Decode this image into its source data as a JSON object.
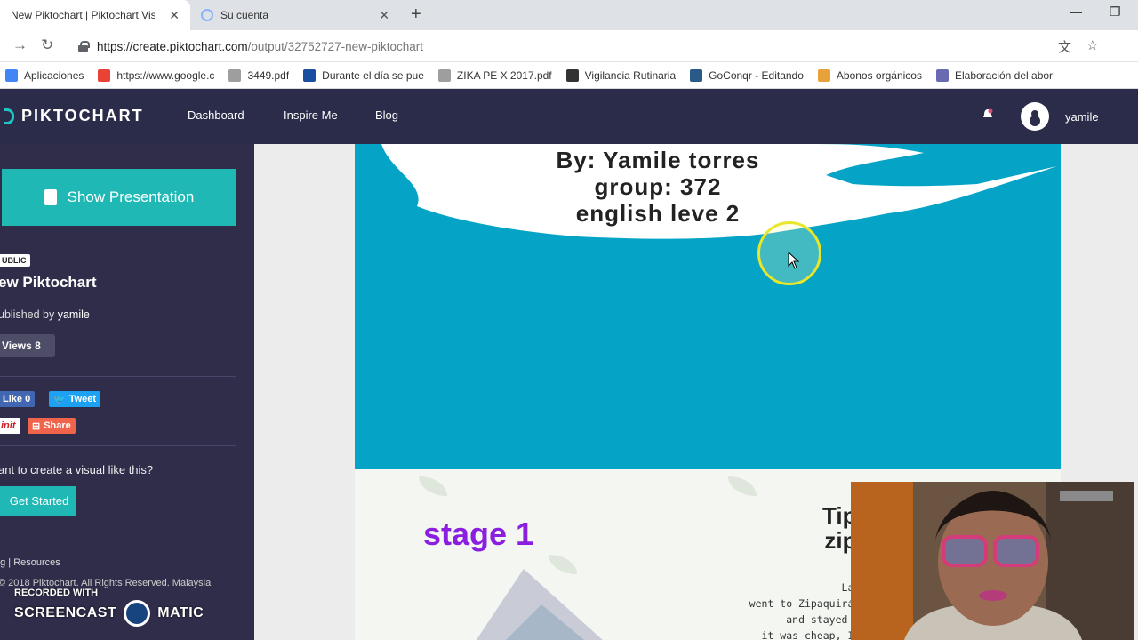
{
  "browser": {
    "tabs": [
      {
        "title": "New Piktochart | Piktochart Visual",
        "close": "✕"
      },
      {
        "title": "Su cuenta",
        "close": "✕"
      }
    ],
    "new_tab": "+",
    "url_host": "https://create.piktochart.com",
    "url_path": "/output/32752727-new-piktochart",
    "bookmarks": [
      {
        "label": "Aplicaciones",
        "color": "#4285f4"
      },
      {
        "label": "https://www.google.c",
        "color": "#ea4335"
      },
      {
        "label": "3449.pdf",
        "color": "#9e9e9e"
      },
      {
        "label": "Durante el día se pue",
        "color": "#1a4fa0"
      },
      {
        "label": "ZIKA PE X 2017.pdf",
        "color": "#9e9e9e"
      },
      {
        "label": "Vigilancia Rutinaria",
        "color": "#333333"
      },
      {
        "label": "GoConqr - Editando",
        "color": "#2a5a8a"
      },
      {
        "label": "Abonos orgánicos",
        "color": "#e8a23a"
      },
      {
        "label": "Elaboración del abor",
        "color": "#6a6ab0"
      }
    ]
  },
  "header": {
    "logo": "PIKTOCHART",
    "nav": [
      "Dashboard",
      "Inspire Me",
      "Blog"
    ],
    "username": "yamile"
  },
  "sidebar": {
    "show_presentation": "Show Presentation",
    "badge": "UBLIC",
    "title": "ew Piktochart",
    "published_by": "ublished by",
    "author": "yamile",
    "views": "Views 8",
    "like": "Like 0",
    "tweet": "Tweet",
    "pinit": "init",
    "share": "Share",
    "want": "ant to create a visual like this?",
    "get_started": "Get Started",
    "links": "og   |    Resources",
    "copyright": "© 2018 Piktochart. All Rights Reserved. Malaysia"
  },
  "canvas": {
    "cover_lines": [
      "By: Yamile torres",
      "group: 372",
      "english leve 2"
    ],
    "stage": "stage 1",
    "tips_lines": [
      "Tips",
      "zipa"
    ],
    "tips_body": [
      "Last va",
      "went to Zipaquirá, I w",
      "and stayed two d",
      "it was cheap, I just"
    ]
  },
  "watermark": {
    "small": "RECORDED WITH",
    "left": "SCREENCAST",
    "right": "MATIC"
  },
  "colors": {
    "header_bg": "#2b2b4a",
    "sidebar_bg": "#2f2d4a",
    "accent": "#1fb8b4",
    "cover_bg": "#05a3c6",
    "stage_color": "#8a1fe0"
  }
}
